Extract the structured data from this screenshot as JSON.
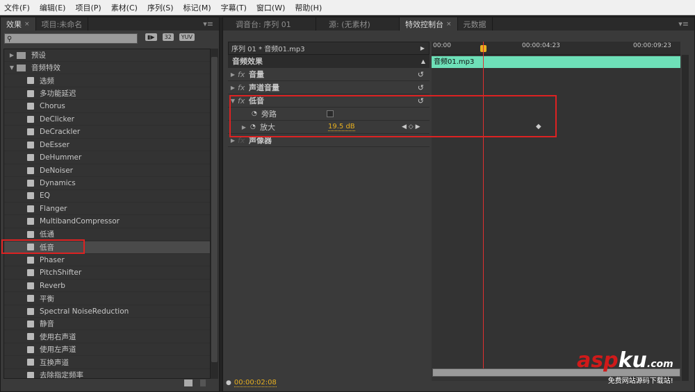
{
  "menu": [
    "文件(F)",
    "编辑(E)",
    "项目(P)",
    "素材(C)",
    "序列(S)",
    "标记(M)",
    "字幕(T)",
    "窗口(W)",
    "帮助(H)"
  ],
  "left_panel": {
    "tabs": [
      {
        "label": "效果",
        "active": true,
        "closable": true
      },
      {
        "label": "项目:未命名",
        "active": false
      }
    ],
    "search": {
      "value": "",
      "placeholder": ""
    },
    "filter_buttons": [
      "accelerated",
      "32",
      "YUV"
    ],
    "folders": [
      {
        "label": "预设",
        "expanded": false
      },
      {
        "label": "音频特效",
        "expanded": true
      }
    ],
    "effects": [
      "选频",
      "多功能延迟",
      "Chorus",
      "DeClicker",
      "DeCrackler",
      "DeEsser",
      "DeHummer",
      "DeNoiser",
      "Dynamics",
      "EQ",
      "Flanger",
      "MultibandCompressor",
      "低通",
      "低音",
      "Phaser",
      "PitchShifter",
      "Reverb",
      "平衡",
      "Spectral NoiseReduction",
      "静音",
      "使用右声道",
      "使用左声道",
      "互换声道",
      "去除指定频率"
    ],
    "selected_effect": "低音"
  },
  "right_panel": {
    "tabs": [
      {
        "label": "调音台: 序列 01",
        "active": false
      },
      {
        "label": "源: (无素材)",
        "active": false
      },
      {
        "label": "特效控制台",
        "active": true,
        "closable": true
      },
      {
        "label": "元数据",
        "active": false
      }
    ],
    "clip_header": "序列 01 * 音频01.mp3",
    "section": "音频效果",
    "effects": [
      {
        "label": "音量",
        "expanded": false
      },
      {
        "label": "声道音量",
        "expanded": false
      },
      {
        "label": "低音",
        "expanded": true,
        "params": [
          {
            "label": "旁路",
            "type": "checkbox",
            "checked": false
          },
          {
            "label": "放大",
            "value": "19.5 dB"
          }
        ]
      },
      {
        "label": "声像器",
        "expanded": false
      }
    ],
    "timeline": {
      "ticks": [
        "00:00",
        "00:00:04:23",
        "00:00:09:23"
      ],
      "clip_label": "音频01.mp3"
    },
    "current_time": "00:00:02:08"
  },
  "watermark": {
    "brand": "aspku.com",
    "tagline": "免费网站源码下载站!"
  },
  "colors": {
    "clip": "#6ee0b8",
    "playhead": "#e03030",
    "value": "#e8b020",
    "highlight": "#d22222"
  }
}
